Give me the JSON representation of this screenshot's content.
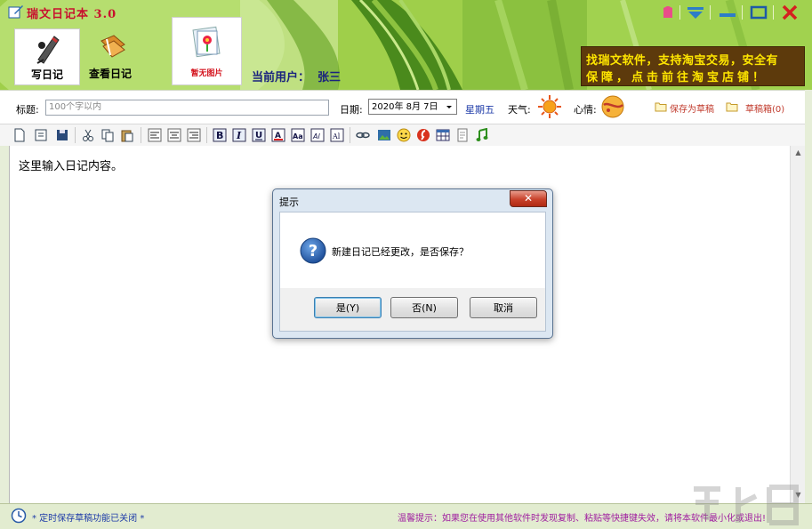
{
  "app": {
    "title": "瑞文日记本 3.0"
  },
  "nav": {
    "write": "写日记",
    "view": "查看日记",
    "no_photo": "暂无图片"
  },
  "user": {
    "label": "当前用户：",
    "name": "张三"
  },
  "promo": {
    "line1": "找瑞文软件，支持淘宝交易，安全有",
    "line2": "保障，点击前往淘宝店铺！"
  },
  "form": {
    "title_label": "标题:",
    "title_placeholder": "100个字以内",
    "date_label": "日期:",
    "date_value": "2020年 8月 7日",
    "weekday": "星期五",
    "weather_label": "天气:",
    "mood_label": "心情:",
    "save_draft": "保存为草稿",
    "draft_box": "草稿箱(0)"
  },
  "editor": {
    "content": "这里输入日记内容。"
  },
  "status": {
    "left": "* 定时保存草稿功能已关闭 *",
    "right": "温馨提示：如果您在使用其他软件时发现复制、粘贴等快捷键失效，请将本软件最小化或退出!"
  },
  "dialog": {
    "title": "提示",
    "message": "新建日记已经更改，是否保存？",
    "yes": "是(Y)",
    "no": "否(N)",
    "cancel": "取消"
  },
  "colors": {
    "brand_red": "#c8102e",
    "promo_bg": "#5d3a0c",
    "promo_text": "#ffe600",
    "link_blue": "#1e3ba8",
    "tip_purple": "#a020a0"
  }
}
